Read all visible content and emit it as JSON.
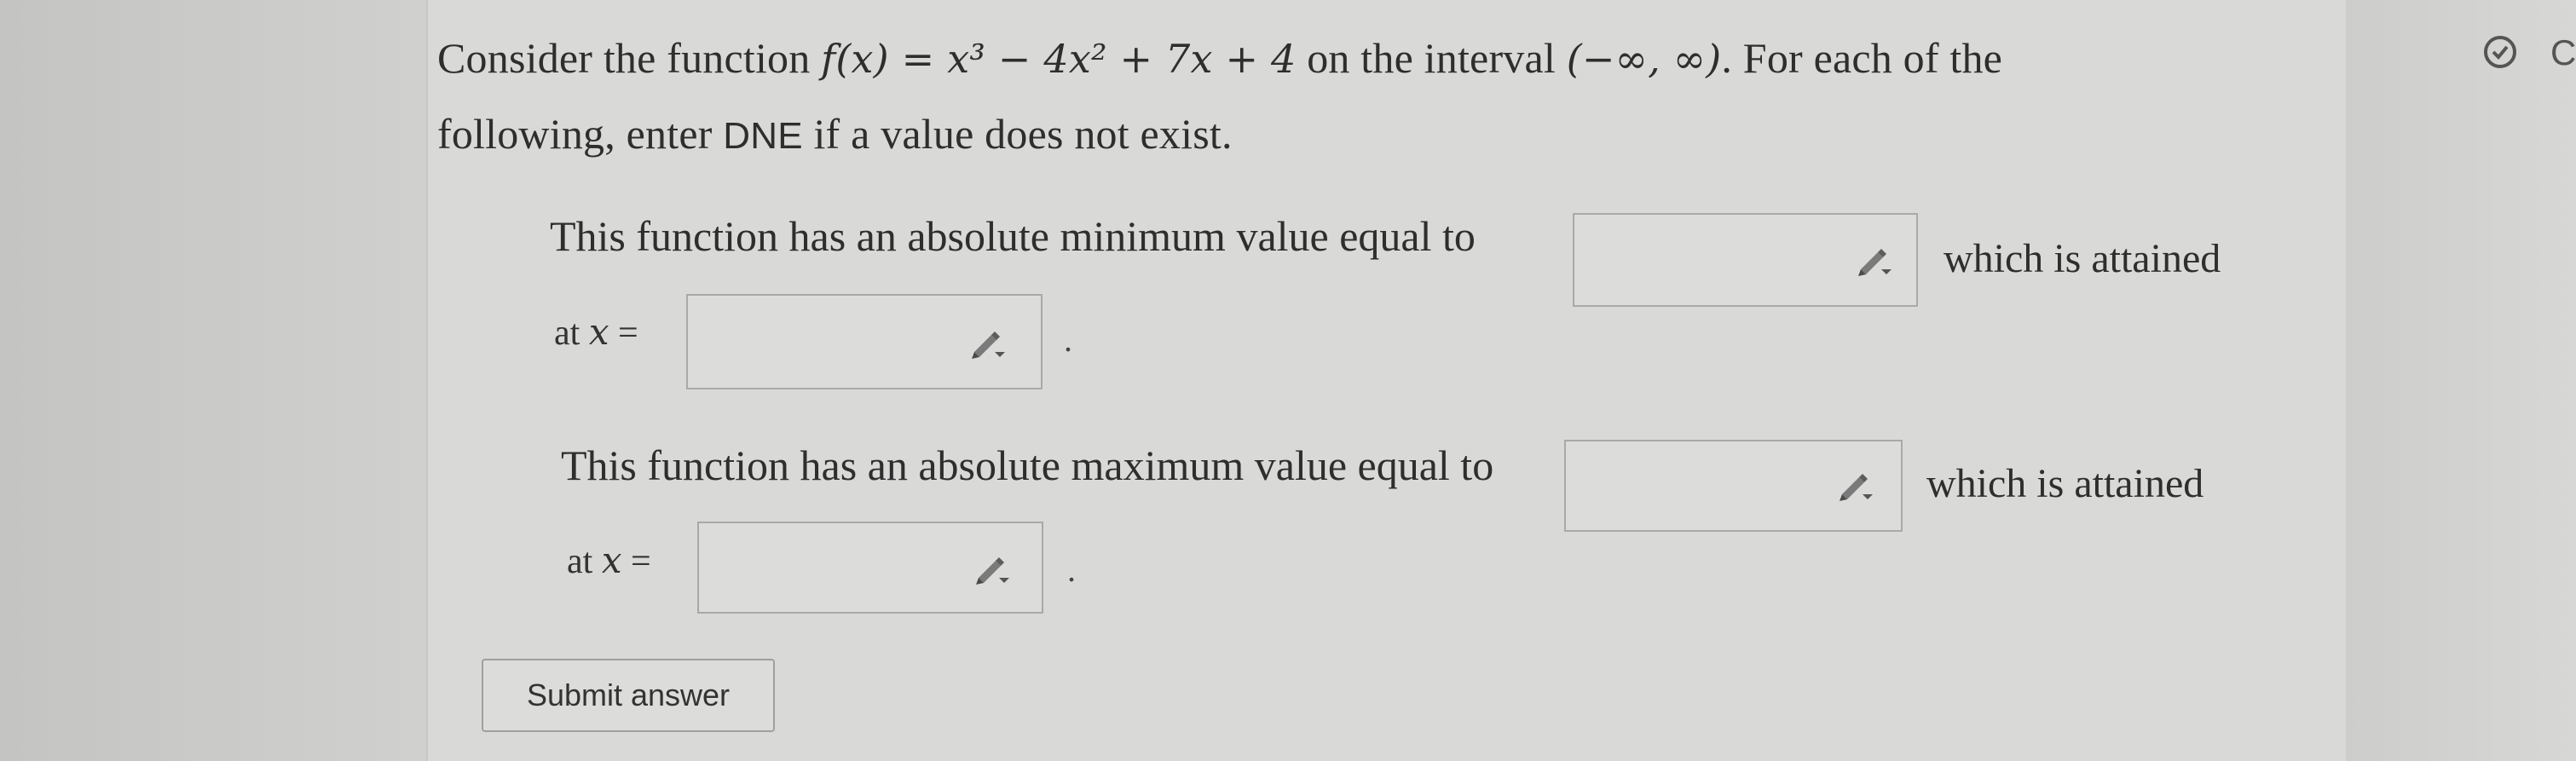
{
  "question": {
    "intro": "Consider the function",
    "function_math": "f(x) = x³ − 4x² + 7x + 4",
    "interval_prefix": "on the interval",
    "interval_math": "(−∞, ∞)",
    "for_each": ". For each of the",
    "line2_prefix": "following, enter",
    "dne": "DNE",
    "line2_suffix": "if a value does not exist."
  },
  "min_part": {
    "prompt": "This function has an absolute minimum value equal to",
    "attained": "which is attained",
    "at_label": "at",
    "x_var": "x",
    "equals": "=",
    "value_input": "",
    "x_input": "",
    "period": "."
  },
  "max_part": {
    "prompt": "This function has an absolute maximum value equal to",
    "attained": "which is attained",
    "at_label": "at",
    "x_var": "x",
    "equals": "=",
    "value_input": "",
    "x_input": "",
    "period": "."
  },
  "submit_label": "Submit answer",
  "top_right": {
    "status_icon": "check-circle-icon",
    "edge_letter": "C"
  },
  "colors": {
    "text": "#2e2e2e",
    "panel": "#d9d9d7",
    "input_border": "#a9a9a7"
  }
}
